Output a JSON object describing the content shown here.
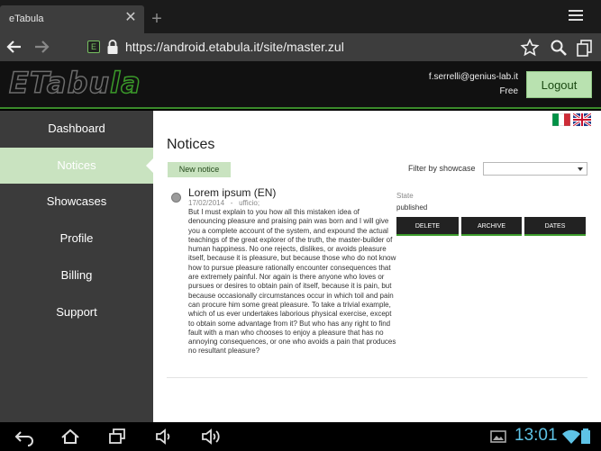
{
  "browser": {
    "tab_title": "eTabula",
    "tab_close": "✕",
    "new_tab": "+",
    "url": "https://android.etabula.it/site/master.zul",
    "favicon_text": "E"
  },
  "header": {
    "logo_main": "ETabu",
    "logo_accent": "la",
    "user_email": "f.serrelli@genius-lab.it",
    "user_plan": "Free",
    "logout_label": "Logout"
  },
  "sidebar": {
    "items": [
      {
        "label": "Dashboard"
      },
      {
        "label": "Notices"
      },
      {
        "label": "Showcases"
      },
      {
        "label": "Profile"
      },
      {
        "label": "Billing"
      },
      {
        "label": "Support"
      }
    ],
    "active_index": 1
  },
  "main": {
    "page_title": "Notices",
    "new_notice_label": "New notice",
    "filter_label": "Filter by showcase",
    "filter_value": "",
    "notice": {
      "title": "Lorem ipsum (EN)",
      "date": "17/02/2014",
      "separator": "-",
      "category": "ufficio;",
      "body": "But I must explain to you how all this mistaken idea of denouncing pleasure and praising pain was born and I will give you a complete account of the system, and expound the actual teachings of the great explorer of the truth, the master-builder of human happiness. No one rejects, dislikes, or avoids pleasure itself, because it is pleasure, but because those who do not know how to pursue pleasure rationally encounter consequences that are extremely painful. Nor again is there anyone who loves or pursues or desires to obtain pain of itself, because it is pain, but because occasionally circumstances occur in which toil and pain can procure him some great pleasure. To take a trivial example, which of us ever undertakes laborious physical exercise, except to obtain some advantage from it? But who has any right to find fault with a man who chooses to enjoy a pleasure that has no annoying consequences, or one who avoids a pain that produces no resultant pleasure?",
      "state_label": "State",
      "state_value": "published",
      "actions": [
        "DELETE",
        "ARCHIVE",
        "DATES"
      ]
    }
  },
  "system": {
    "clock": "13:01"
  },
  "colors": {
    "accent_green": "#3b9a2a",
    "active_bg": "#c9e3c0",
    "clock_blue": "#5ec3e6"
  }
}
